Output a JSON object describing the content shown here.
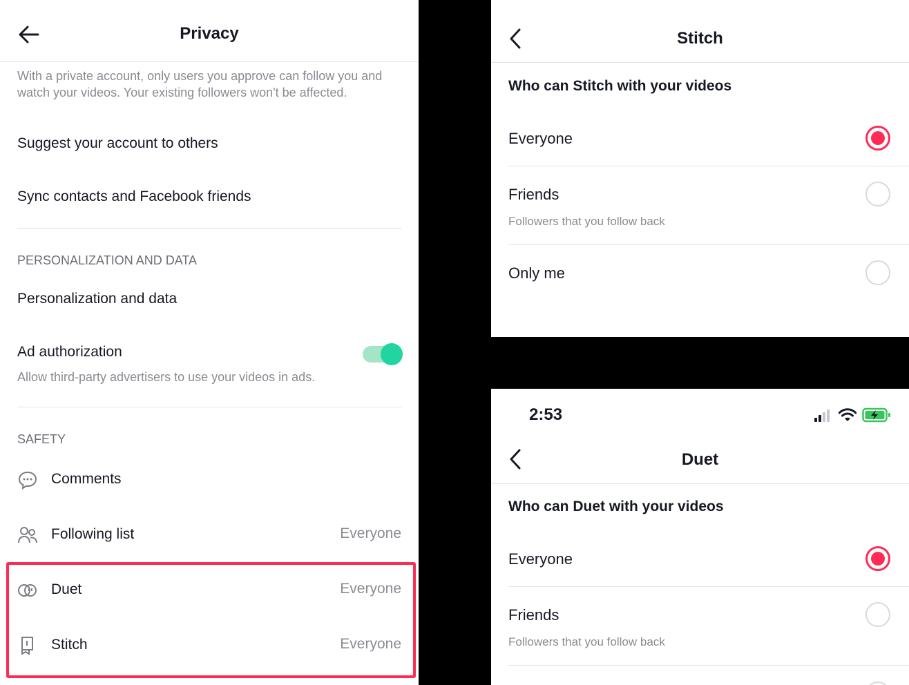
{
  "privacy": {
    "title": "Privacy",
    "private_account_description": "With a private account, only users you approve can follow you and watch your videos. Your existing followers won't be affected.",
    "suggest_account": "Suggest your account to others",
    "sync_contacts": "Sync contacts and Facebook friends",
    "section_personalization": "PERSONALIZATION AND DATA",
    "personalization_item": "Personalization and data",
    "ad_authorization": {
      "label": "Ad authorization",
      "description": "Allow third-party advertisers to use your videos in ads.",
      "enabled": true
    },
    "section_safety": "SAFETY",
    "safety_items": [
      {
        "label": "Comments",
        "value": "",
        "icon": "comment-bubble-icon"
      },
      {
        "label": "Following list",
        "value": "Everyone",
        "icon": "people-icon"
      },
      {
        "label": "Duet",
        "value": "Everyone",
        "icon": "duet-icon"
      },
      {
        "label": "Stitch",
        "value": "Everyone",
        "icon": "stitch-icon"
      }
    ],
    "highlight_color": "#fe2c55"
  },
  "stitch": {
    "title": "Stitch",
    "question": "Who can Stitch with your videos",
    "options": [
      {
        "label": "Everyone",
        "sub": "",
        "selected": true
      },
      {
        "label": "Friends",
        "sub": "Followers that you follow back",
        "selected": false
      },
      {
        "label": "Only me",
        "sub": "",
        "selected": false
      }
    ]
  },
  "duet": {
    "status_time": "2:53",
    "title": "Duet",
    "question": "Who can Duet with your videos",
    "options": [
      {
        "label": "Everyone",
        "sub": "",
        "selected": true
      },
      {
        "label": "Friends",
        "sub": "Followers that you follow back",
        "selected": false
      }
    ]
  },
  "colors": {
    "accent": "#fe2c55",
    "toggle_on": "#20d5a0",
    "battery_charging": "#35c759"
  }
}
